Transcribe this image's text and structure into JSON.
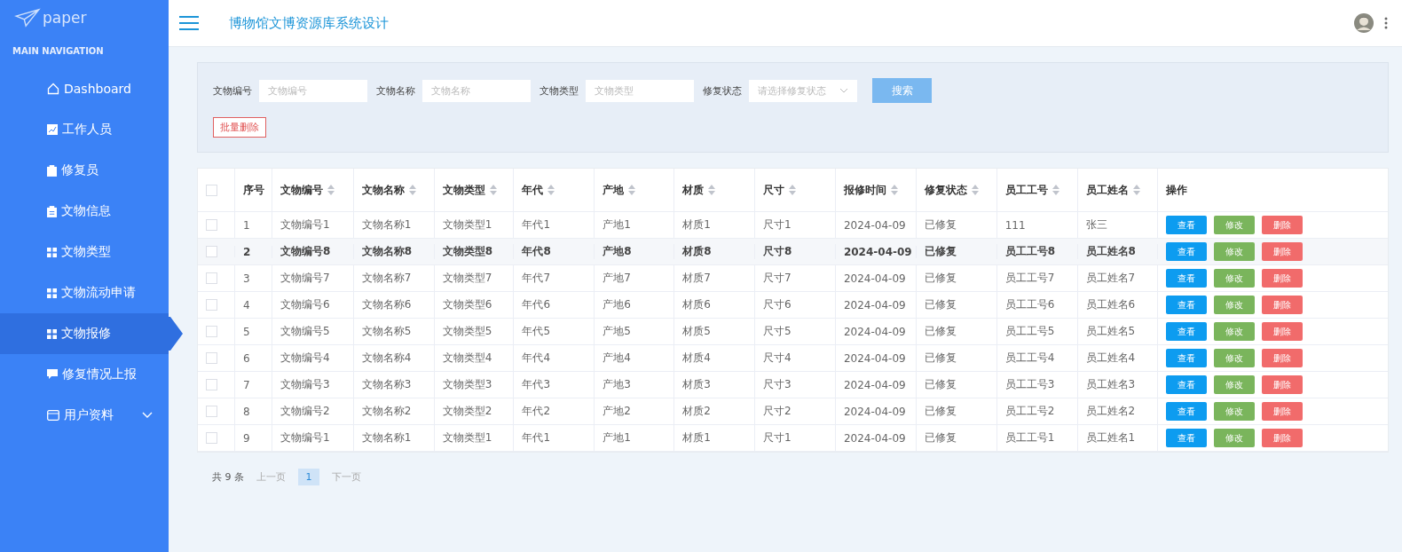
{
  "sidebar": {
    "logo": "paper",
    "section": "MAIN NAVIGATION",
    "items": [
      {
        "label": "Dashboard",
        "kind": "home",
        "selected": false
      },
      {
        "label": "工作人员",
        "kind": "chart",
        "selected": false
      },
      {
        "label": "修复员",
        "kind": "clipboard",
        "selected": false
      },
      {
        "label": "文物信息",
        "kind": "doc",
        "selected": false
      },
      {
        "label": "文物类型",
        "kind": "grid",
        "selected": false
      },
      {
        "label": "文物流动申请",
        "kind": "grid",
        "selected": false
      },
      {
        "label": "文物报修",
        "kind": "grid",
        "selected": true
      },
      {
        "label": "修复情况上报",
        "kind": "chat",
        "selected": false
      },
      {
        "label": "用户资料",
        "kind": "card",
        "selected": false,
        "expanded": false
      }
    ]
  },
  "header": {
    "title": "博物馆文博资源库系统设计"
  },
  "search": {
    "fields": [
      {
        "label": "文物编号",
        "placeholder": "文物编号",
        "kind": "input"
      },
      {
        "label": "文物名称",
        "placeholder": "文物名称",
        "kind": "input"
      },
      {
        "label": "文物类型",
        "placeholder": "文物类型",
        "kind": "input"
      },
      {
        "label": "修复状态",
        "placeholder": "请选择修复状态",
        "kind": "select"
      }
    ],
    "search_button": "搜索",
    "batch_delete_button": "批量删除"
  },
  "table": {
    "columns": [
      {
        "label": "序号",
        "sortable": false
      },
      {
        "label": "文物编号",
        "sortable": true
      },
      {
        "label": "文物名称",
        "sortable": true
      },
      {
        "label": "文物类型",
        "sortable": true
      },
      {
        "label": "年代",
        "sortable": true
      },
      {
        "label": "产地",
        "sortable": true
      },
      {
        "label": "材质",
        "sortable": true
      },
      {
        "label": "尺寸",
        "sortable": true
      },
      {
        "label": "报修时间",
        "sortable": true
      },
      {
        "label": "修复状态",
        "sortable": true
      },
      {
        "label": "员工工号",
        "sortable": true
      },
      {
        "label": "员工姓名",
        "sortable": true
      },
      {
        "label": "操作",
        "sortable": false
      }
    ],
    "all_checked": false,
    "rows": [
      {
        "checked": false,
        "selected": false,
        "cells": [
          "1",
          "文物编号1",
          "文物名称1",
          "文物类型1",
          "年代1",
          "产地1",
          "材质1",
          "尺寸1",
          "2024-04-09",
          "已修复",
          "111",
          "张三"
        ],
        "actions": [
          "查看",
          "修改",
          "删除"
        ]
      },
      {
        "checked": false,
        "selected": true,
        "cells": [
          "2",
          "文物编号8",
          "文物名称8",
          "文物类型8",
          "年代8",
          "产地8",
          "材质8",
          "尺寸8",
          "2024-04-09",
          "已修复",
          "员工工号8",
          "员工姓名8"
        ],
        "actions": [
          "查看",
          "修改",
          "删除"
        ]
      },
      {
        "checked": false,
        "selected": false,
        "cells": [
          "3",
          "文物编号7",
          "文物名称7",
          "文物类型7",
          "年代7",
          "产地7",
          "材质7",
          "尺寸7",
          "2024-04-09",
          "已修复",
          "员工工号7",
          "员工姓名7"
        ],
        "actions": [
          "查看",
          "修改",
          "删除"
        ]
      },
      {
        "checked": false,
        "selected": false,
        "cells": [
          "4",
          "文物编号6",
          "文物名称6",
          "文物类型6",
          "年代6",
          "产地6",
          "材质6",
          "尺寸6",
          "2024-04-09",
          "已修复",
          "员工工号6",
          "员工姓名6"
        ],
        "actions": [
          "查看",
          "修改",
          "删除"
        ]
      },
      {
        "checked": false,
        "selected": false,
        "cells": [
          "5",
          "文物编号5",
          "文物名称5",
          "文物类型5",
          "年代5",
          "产地5",
          "材质5",
          "尺寸5",
          "2024-04-09",
          "已修复",
          "员工工号5",
          "员工姓名5"
        ],
        "actions": [
          "查看",
          "修改",
          "删除"
        ]
      },
      {
        "checked": false,
        "selected": false,
        "cells": [
          "6",
          "文物编号4",
          "文物名称4",
          "文物类型4",
          "年代4",
          "产地4",
          "材质4",
          "尺寸4",
          "2024-04-09",
          "已修复",
          "员工工号4",
          "员工姓名4"
        ],
        "actions": [
          "查看",
          "修改",
          "删除"
        ]
      },
      {
        "checked": false,
        "selected": false,
        "cells": [
          "7",
          "文物编号3",
          "文物名称3",
          "文物类型3",
          "年代3",
          "产地3",
          "材质3",
          "尺寸3",
          "2024-04-09",
          "已修复",
          "员工工号3",
          "员工姓名3"
        ],
        "actions": [
          "查看",
          "修改",
          "删除"
        ]
      },
      {
        "checked": false,
        "selected": false,
        "cells": [
          "8",
          "文物编号2",
          "文物名称2",
          "文物类型2",
          "年代2",
          "产地2",
          "材质2",
          "尺寸2",
          "2024-04-09",
          "已修复",
          "员工工号2",
          "员工姓名2"
        ],
        "actions": [
          "查看",
          "修改",
          "删除"
        ]
      },
      {
        "checked": false,
        "selected": false,
        "cells": [
          "9",
          "文物编号1",
          "文物名称1",
          "文物类型1",
          "年代1",
          "产地1",
          "材质1",
          "尺寸1",
          "2024-04-09",
          "已修复",
          "员工工号1",
          "员工姓名1"
        ],
        "actions": [
          "查看",
          "修改",
          "删除"
        ]
      }
    ]
  },
  "pagination": {
    "total": "共 9 条",
    "prev": "上一页",
    "next": "下一页",
    "prev_disabled": true,
    "next_disabled": true,
    "pages": [
      {
        "label": "1",
        "selected": true
      }
    ]
  }
}
